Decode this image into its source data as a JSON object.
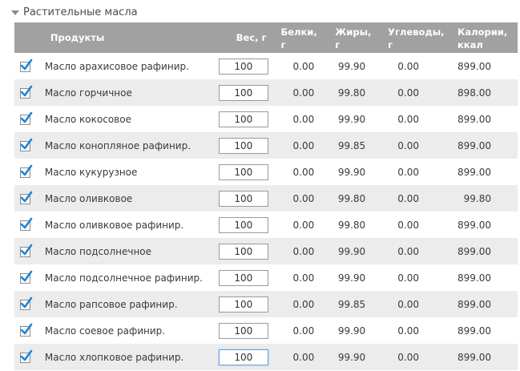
{
  "section": {
    "title": "Растительные масла",
    "expand_icon": "triangle-down-icon"
  },
  "columns": {
    "product": "Продукты",
    "weight": "Вес, г",
    "protein": [
      "Белки,",
      "г"
    ],
    "fat": [
      "Жиры,",
      "г"
    ],
    "carbs": [
      "Углеводы,",
      "г"
    ],
    "calories": [
      "Калории,",
      "ккал"
    ]
  },
  "rows": [
    {
      "checked": true,
      "name": "Масло арахисовое рафинир.",
      "weight": "100",
      "protein": "0.00",
      "fat": "99.90",
      "carbs": "0.00",
      "calories": "899.00"
    },
    {
      "checked": true,
      "name": "Масло горчичное",
      "weight": "100",
      "protein": "0.00",
      "fat": "99.80",
      "carbs": "0.00",
      "calories": "898.00"
    },
    {
      "checked": true,
      "name": "Масло кокосовое",
      "weight": "100",
      "protein": "0.00",
      "fat": "99.90",
      "carbs": "0.00",
      "calories": "899.00"
    },
    {
      "checked": true,
      "name": "Масло конопляное рафинир.",
      "weight": "100",
      "protein": "0.00",
      "fat": "99.85",
      "carbs": "0.00",
      "calories": "899.00"
    },
    {
      "checked": true,
      "name": "Масло кукурузное",
      "weight": "100",
      "protein": "0.00",
      "fat": "99.90",
      "carbs": "0.00",
      "calories": "899.00"
    },
    {
      "checked": true,
      "name": "Масло оливковое",
      "weight": "100",
      "protein": "0.00",
      "fat": "99.80",
      "carbs": "0.00",
      "calories": "99.80"
    },
    {
      "checked": true,
      "name": "Масло оливковое рафинир.",
      "weight": "100",
      "protein": "0.00",
      "fat": "99.80",
      "carbs": "0.00",
      "calories": "899.00"
    },
    {
      "checked": true,
      "name": "Масло подсолнечное",
      "weight": "100",
      "protein": "0.00",
      "fat": "99.90",
      "carbs": "0.00",
      "calories": "899.00"
    },
    {
      "checked": true,
      "name": "Масло подсолнечное рафинир.",
      "weight": "100",
      "protein": "0.00",
      "fat": "99.90",
      "carbs": "0.00",
      "calories": "899.00"
    },
    {
      "checked": true,
      "name": "Масло рапсовое рафинир.",
      "weight": "100",
      "protein": "0.00",
      "fat": "99.85",
      "carbs": "0.00",
      "calories": "899.00"
    },
    {
      "checked": true,
      "name": "Масло соевое рафинир.",
      "weight": "100",
      "protein": "0.00",
      "fat": "99.90",
      "carbs": "0.00",
      "calories": "899.00"
    },
    {
      "checked": true,
      "name": "Масло хлопковое рафинир.",
      "weight": "100",
      "protein": "0.00",
      "fat": "99.90",
      "carbs": "0.00",
      "calories": "899.00",
      "focused": true
    }
  ],
  "colors": {
    "header_bg": "#a1a1a1",
    "row_alt_bg": "#ececec",
    "check_color": "#1d86d3"
  }
}
